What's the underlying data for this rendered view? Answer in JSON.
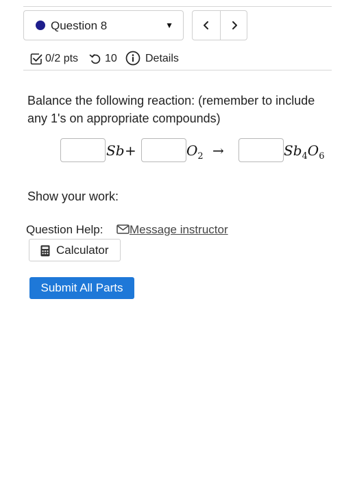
{
  "question_nav": {
    "selected": "Question 8",
    "prev_icon": "chevron-left-icon",
    "next_icon": "chevron-right-icon"
  },
  "meta": {
    "points": "0/2 pts",
    "attempts": "10",
    "details": "Details"
  },
  "question": {
    "prompt": "Balance the following reaction:  (remember to include any 1's on appropriate compounds)",
    "equation": {
      "reactant1": "Sb",
      "plus": "+",
      "reactant2_base": "O",
      "reactant2_sub": "2",
      "arrow": "→",
      "product_sb": "Sb",
      "product_sb_sub": "4",
      "product_o": "O",
      "product_o_sub": "6"
    },
    "answers": [
      "",
      "",
      ""
    ],
    "show_work": "Show your work:"
  },
  "help": {
    "label": "Question Help:",
    "message_link": "Message instructor",
    "calculator": "Calculator"
  },
  "submit_label": "Submit All Parts",
  "colors": {
    "accent": "#1e78d8",
    "dot": "#1e1e8c"
  }
}
